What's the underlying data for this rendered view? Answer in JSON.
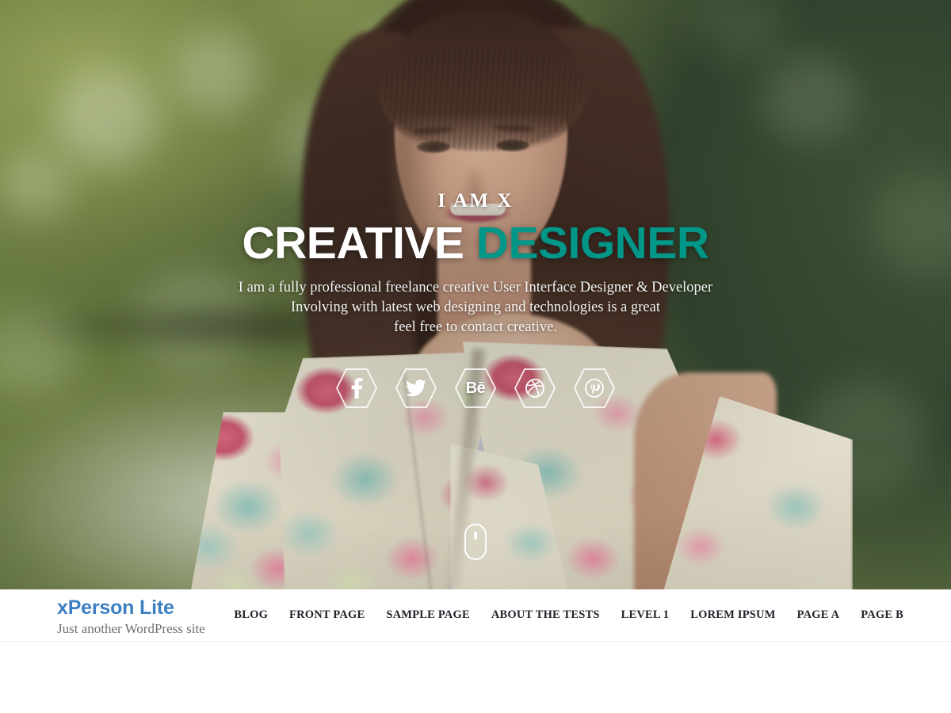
{
  "hero": {
    "pretitle": "I AM X",
    "title_white": "CREATIVE ",
    "title_accent": "DESIGNER",
    "accent_color": "#009688",
    "description": "I am a fully professional freelance creative User Interface Designer & Developer Involving with latest web designing and technologies is a great feel free to contact creative.",
    "description_lines": [
      "I am a fully professional freelance creative User Interface Designer & Developer",
      "Involving with latest web designing and technologies is a great",
      "feel free to contact creative."
    ],
    "background_description": "Smiling woman with brown hair and bangs wearing a floral print jacket, blurred green foliage background",
    "social": [
      {
        "name": "facebook",
        "icon": "facebook-icon",
        "glyph": "f"
      },
      {
        "name": "twitter",
        "icon": "twitter-icon",
        "glyph": ""
      },
      {
        "name": "behance",
        "icon": "behance-icon",
        "glyph": "Bē"
      },
      {
        "name": "dribbble",
        "icon": "dribbble-icon",
        "glyph": ""
      },
      {
        "name": "pinterest",
        "icon": "pinterest-icon",
        "glyph": ""
      }
    ],
    "scroll_indicator": "scroll-down-mouse-icon"
  },
  "header": {
    "site_title": "xPerson Lite",
    "site_title_color": "#3d7fc1",
    "tagline": "Just another WordPress site",
    "nav": [
      {
        "label": "BLOG"
      },
      {
        "label": "FRONT PAGE"
      },
      {
        "label": "SAMPLE PAGE"
      },
      {
        "label": "ABOUT THE TESTS"
      },
      {
        "label": "LEVEL 1"
      },
      {
        "label": "LOREM IPSUM"
      },
      {
        "label": "PAGE A"
      },
      {
        "label": "PAGE B"
      }
    ]
  }
}
